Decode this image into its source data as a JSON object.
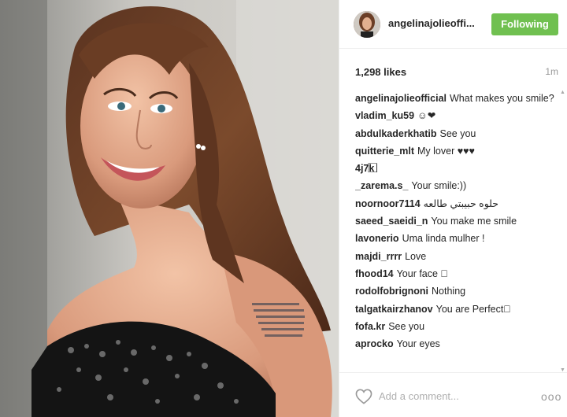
{
  "post": {
    "username": "angelinajolieoffi...",
    "follow_label": "Following",
    "likes": "1,298 likes",
    "time_ago": "1m",
    "caption_user": "angelinajolieofficial",
    "caption_text": "What makes you smile?",
    "add_comment_placeholder": "Add a comment...",
    "more_label": "ooo"
  },
  "comments": [
    {
      "user": "vladim_ku59",
      "text": "☺❤"
    },
    {
      "user": "abdulkaderkhatib",
      "text": "See you"
    },
    {
      "user": "quitterie_mlt",
      "text": "My lover ♥♥♥"
    },
    {
      "user": "4j7k",
      "text": "⃞⃞⃞⃞⃞⃞"
    },
    {
      "user": "_zarema.s_",
      "text": "Your smile:))"
    },
    {
      "user": "noornoor7114",
      "text": "حلوه حبيبتي طالعه"
    },
    {
      "user": "saeed_saeidi_n",
      "text": "You make me smile"
    },
    {
      "user": "lavonerio",
      "text": "Uma linda mulher !"
    },
    {
      "user": "majdi_rrrr",
      "text": "Love"
    },
    {
      "user": "fhood14",
      "text": "Your face ⃞"
    },
    {
      "user": "rodolfobrignoni",
      "text": "Nothing"
    },
    {
      "user": "talgatkairzhanov",
      "text": "You are Perfect⃞"
    },
    {
      "user": "fofa.kr",
      "text": "See you"
    },
    {
      "user": "aprocko",
      "text": "Your eyes"
    }
  ],
  "colors": {
    "follow_button": "#70c050",
    "text": "#262626",
    "muted": "#999999"
  },
  "icons": {
    "like": "heart-outline-icon",
    "more": "more-options-icon"
  }
}
